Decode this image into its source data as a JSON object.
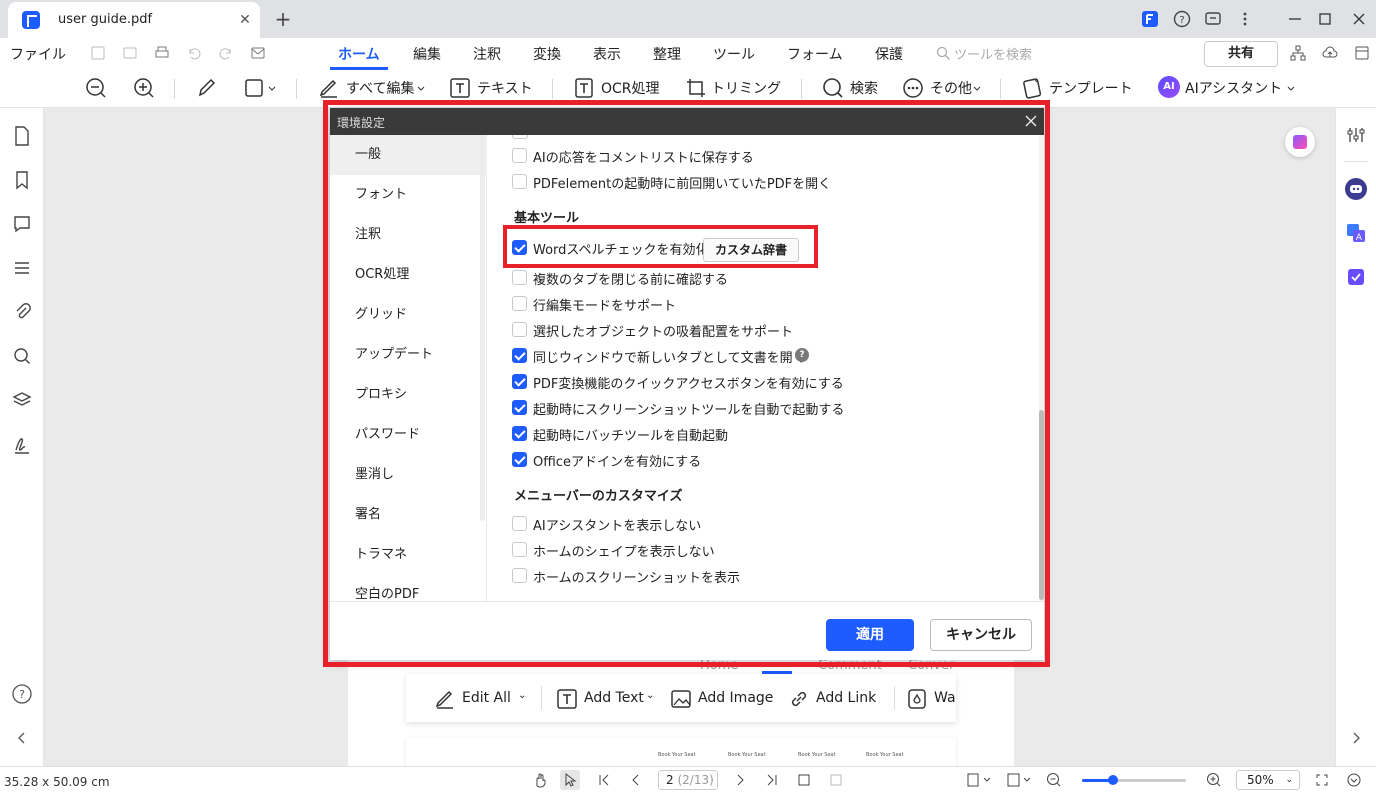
{
  "window": {
    "tab_title": "user guide.pdf"
  },
  "menubar": {
    "file": "ファイル",
    "tabs": [
      "ホーム",
      "編集",
      "注釈",
      "変換",
      "表示",
      "整理",
      "ツール",
      "フォーム",
      "保護"
    ],
    "search_placeholder": "ツールを検索",
    "share": "共有"
  },
  "toolbar": {
    "edit_all": "すべて編集",
    "text": "テキスト",
    "ocr": "OCR処理",
    "crop": "トリミング",
    "search": "検索",
    "more": "その他",
    "template": "テンプレート",
    "ai": "AIアシスタント",
    "ai_badge": "AI"
  },
  "dialog": {
    "title": "環境設定",
    "nav": [
      "一般",
      "フォント",
      "注釈",
      "OCR処理",
      "グリッド",
      "アップデート",
      "プロキシ",
      "パスワード",
      "墨消し",
      "署名",
      "トラマネ",
      "空白のPDF"
    ],
    "options_top": [
      {
        "label": "AIの応答をコメントリストに保存する",
        "checked": false
      },
      {
        "label": "PDFelementの起動時に前回開いていたPDFを開く",
        "checked": false
      }
    ],
    "section_basic": "基本ツール",
    "options_basic": [
      {
        "label": "Wordスペルチェックを有効化",
        "checked": true
      },
      {
        "label": "複数のタブを閉じる前に確認する",
        "checked": false
      },
      {
        "label": "行編集モードをサポート",
        "checked": false
      },
      {
        "label": "選択したオブジェクトの吸着配置をサポート",
        "checked": false
      },
      {
        "label": "同じウィンドウで新しいタブとして文書を開く",
        "checked": true
      },
      {
        "label": "PDF変換機能のクイックアクセスボタンを有効にする",
        "checked": true
      },
      {
        "label": "起動時にスクリーンショットツールを自動で起動する",
        "checked": true
      },
      {
        "label": "起動時にバッチツールを自動起動",
        "checked": true
      },
      {
        "label": "Officeアドインを有効にする",
        "checked": true
      }
    ],
    "custom_dict": "カスタム辞書",
    "section_menu": "メニューバーのカスタマイズ",
    "options_menu": [
      {
        "label": "AIアシスタントを表示しない",
        "checked": false
      },
      {
        "label": "ホームのシェイプを表示しない",
        "checked": false
      },
      {
        "label": "ホームのスクリーンショットを表示",
        "checked": false
      }
    ],
    "apply": "適用",
    "cancel": "キャンセル"
  },
  "page_preview": {
    "tabs": [
      "Home",
      "Comment",
      "Conver"
    ],
    "tools": [
      "Edit All",
      "Add Text",
      "Add Image",
      "Add Link",
      "Wa"
    ],
    "thumb_labels": [
      "Book Your Seat",
      "Book Your Seat",
      "Book Your Seat",
      "Book Your Seat"
    ]
  },
  "statusbar": {
    "dimensions": "35.28 x 50.09 cm",
    "page_current": "2",
    "page_info": "(2/13)",
    "zoom": "50%",
    "zoom_fraction": 0.3
  },
  "colors": {
    "accent": "#1f5cff",
    "highlight": "#e8202a"
  }
}
